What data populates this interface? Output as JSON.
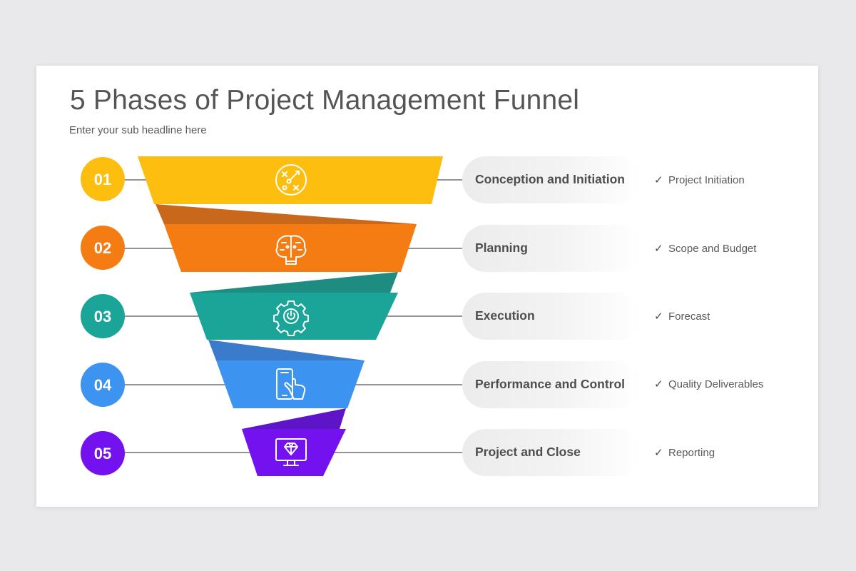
{
  "title": "5 Phases of Project Management Funnel",
  "subtitle": "Enter your sub headline here",
  "check_symbol": "✓",
  "stages": [
    {
      "number": "01",
      "name": "Conception and Initiation",
      "detail": "Project Initiation",
      "color": "#FDBE0F",
      "fold_color": "#C9671A",
      "icon": "strategy-icon"
    },
    {
      "number": "02",
      "name": "Planning",
      "detail": "Scope and Budget",
      "color": "#F57C13",
      "fold_color": "#1E8C80",
      "icon": "brain-icon"
    },
    {
      "number": "03",
      "name": "Execution",
      "detail": "Forecast",
      "color": "#1BA598",
      "fold_color": "#3A7BCB",
      "icon": "gear-icon"
    },
    {
      "number": "04",
      "name": "Performance and Control",
      "detail": "Quality Deliverables",
      "color": "#3D93F0",
      "fold_color": "#5E15C8",
      "icon": "touch-phone-icon"
    },
    {
      "number": "05",
      "name": "Project and Close",
      "detail": "Reporting",
      "color": "#7311EF",
      "fold_color": "",
      "icon": "monitor-diamond-icon"
    }
  ]
}
